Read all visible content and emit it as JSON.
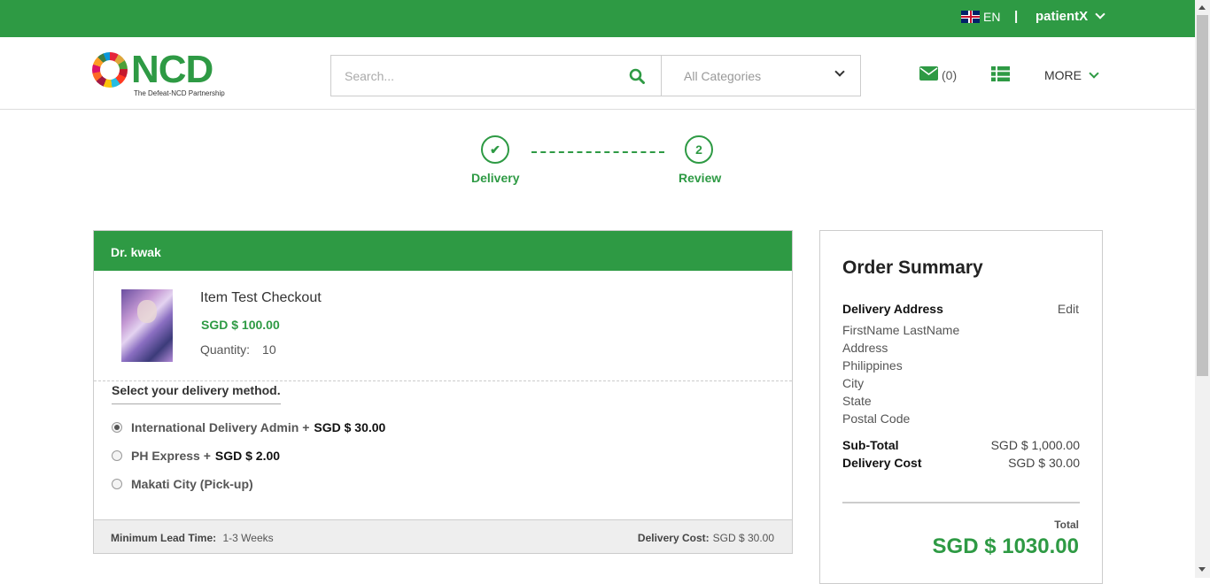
{
  "topbar": {
    "language": "EN",
    "separator": "|",
    "username": "patientX"
  },
  "header": {
    "logo_text": "NCD",
    "logo_tagline": "The Defeat-NCD Partnership",
    "search_placeholder": "Search...",
    "category_selected": "All Categories",
    "mail_count": "(0)",
    "more_label": "MORE"
  },
  "steps": [
    {
      "label": "Delivery",
      "marker": "✔",
      "state": "complete"
    },
    {
      "label": "Review",
      "marker": "2",
      "state": "pending"
    }
  ],
  "seller": {
    "name": "Dr. kwak",
    "item": {
      "title": "Item Test Checkout",
      "price": "SGD $  100.00",
      "quantity_label": "Quantity:",
      "quantity": "10"
    },
    "delivery": {
      "prompt": "Select your delivery method.",
      "options": [
        {
          "label": "International Delivery Admin +",
          "cost": "SGD $  30.00",
          "selected": true
        },
        {
          "label": "PH Express +",
          "cost": "SGD $  2.00",
          "selected": false
        },
        {
          "label": "Makati City (Pick-up)",
          "cost": "",
          "selected": false
        }
      ]
    },
    "footer": {
      "lead_time_label": "Minimum Lead Time:",
      "lead_time_value": "1-3 Weeks",
      "delivery_cost_label": "Delivery Cost:",
      "delivery_cost_value": "SGD $  30.00"
    }
  },
  "summary": {
    "title": "Order Summary",
    "address_heading": "Delivery Address",
    "edit_label": "Edit",
    "address_lines": [
      "FirstName LastName",
      "Address",
      "Philippines",
      "City",
      "State",
      "Postal Code"
    ],
    "subtotal_label": "Sub-Total",
    "subtotal_value": "SGD $  1,000.00",
    "delivery_cost_label": "Delivery Cost",
    "delivery_cost_value": "SGD $  30.00",
    "total_label": "Total",
    "total_value": "SGD $  1030.00"
  },
  "colors": {
    "brand_green": "#2e9a44"
  }
}
